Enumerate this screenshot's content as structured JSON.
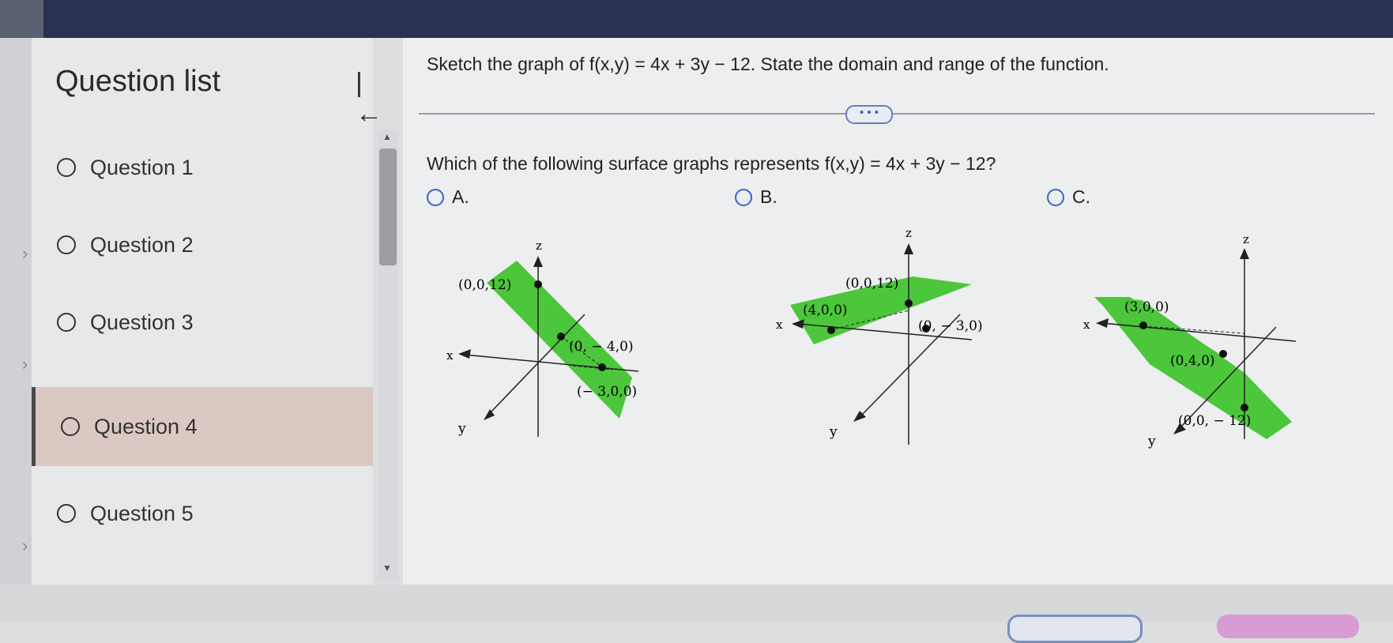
{
  "sidebar": {
    "title": "Question list",
    "collapse_icon": "collapse-left-icon",
    "items": [
      {
        "label": "Question 1",
        "selected": false
      },
      {
        "label": "Question 2",
        "selected": false
      },
      {
        "label": "Question 3",
        "selected": false
      },
      {
        "label": "Question 4",
        "selected": true
      },
      {
        "label": "Question 5",
        "selected": false
      }
    ]
  },
  "main": {
    "question": "Sketch the graph of f(x,y) = 4x + 3y − 12. State the domain and range of the function.",
    "more_button": "• • •",
    "prompt": "Which of the following surface graphs represents f(x,y) = 4x + 3y − 12?",
    "options": [
      {
        "label": "A.",
        "axes": {
          "x": "x",
          "y": "y",
          "z": "z"
        },
        "points": [
          "(0,0,12)",
          "(0, − 4,0)",
          "(− 3,0,0)"
        ]
      },
      {
        "label": "B.",
        "axes": {
          "x": "x",
          "y": "y",
          "z": "z"
        },
        "points": [
          "(0,0,12)",
          "(4,0,0)",
          "(0, − 3,0)"
        ]
      },
      {
        "label": "C.",
        "axes": {
          "x": "x",
          "y": "y",
          "z": "z"
        },
        "points": [
          "(3,0,0)",
          "(0,4,0)",
          "(0,0, − 12)"
        ]
      }
    ]
  },
  "colors": {
    "plane": "#4cc63a",
    "accent": "#3a64c8",
    "selected_row": "#dcc8c2"
  }
}
